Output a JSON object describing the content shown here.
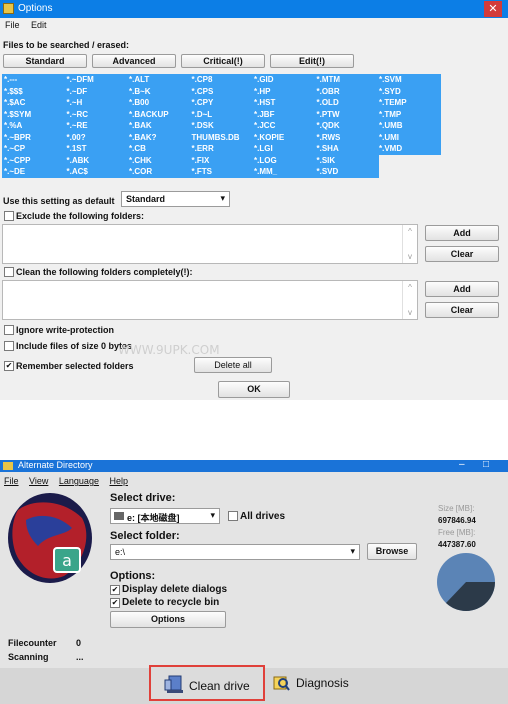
{
  "options_window": {
    "title": "Options",
    "close_label": "✕",
    "menu": [
      "File",
      "Edit"
    ],
    "files_label": "Files to be searched / erased:",
    "buttons": [
      "Standard",
      "Advanced",
      "Critical(!)",
      "Edit(!)"
    ],
    "ext_columns": [
      [
        "*.---",
        "*.$$$",
        "*.$AC",
        "*.$SYM",
        "*.%A",
        "*.~BPR",
        "*.~CP",
        "*.~CPP",
        "*.~DE"
      ],
      [
        "*.~DFM",
        "*.~DF",
        "*.~H",
        "*.~RC",
        "*.~RE",
        "*.00?",
        "*.1ST",
        "*.ABK",
        "*.AC$"
      ],
      [
        "*.ALT",
        "*.B~K",
        "*.B00",
        "*.BACKUP",
        "*.BAK",
        "*.BAK?",
        "*.CB",
        "*.CHK",
        "*.COR"
      ],
      [
        "*.CP8",
        "*.CPS",
        "*.CPY",
        "*.D~L",
        "*.DSK",
        "THUMBS.DB",
        "*.ERR",
        "*.FIX",
        "*.FTS"
      ],
      [
        "*.GID",
        "*.HP",
        "*.HST",
        "*.JBF",
        "*.JCC",
        "*.KOPIE",
        "*.LGI",
        "*.LOG",
        "*.MM_"
      ],
      [
        "*.MTM",
        "*.OBR",
        "*.OLD",
        "*.PTW",
        "*.QDK",
        "*.RWS",
        "*.SHA",
        "*.SIK",
        "*.SVD"
      ],
      [
        "*.SVM",
        "*.SYD",
        "*.TEMP",
        "*.TMP",
        "*.UMB",
        "*.UMI",
        "*.VMD"
      ]
    ],
    "default_label": "Use this setting as default",
    "default_value": "Standard",
    "exclude_label": "Exclude the following folders:",
    "clean_label": "Clean the following folders completely(!):",
    "add_label": "Add",
    "clear_label": "Clear",
    "ignore_label": "Ignore write-protection",
    "include_label": "Include files of size 0 bytes",
    "remember_label": "Remember selected folders",
    "delete_all_label": "Delete all",
    "ok_label": "OK",
    "scroll_up": "^",
    "scroll_down": "v",
    "check_mark": "✔"
  },
  "watermark": "WWW.9UPK.COM",
  "alt_window": {
    "title": "Alternate Directory",
    "win_controls": [
      "–",
      "□"
    ],
    "menu": [
      "File",
      "View",
      "Language",
      "Help"
    ],
    "select_drive_label": "Select drive:",
    "drive_value": "e: [本地磁盘]",
    "all_drives_label": "All drives",
    "select_folder_label": "Select folder:",
    "folder_value": "e:\\",
    "browse_label": "Browse",
    "options_label": "Options:",
    "display_delete_label": "Display delete dialogs",
    "delete_recycle_label": "Delete to recycle bin",
    "options_button_label": "Options",
    "size_label": "Size [MB]:",
    "size_value": "697846.94",
    "free_label": "Free [MB]:",
    "free_value": "447387.60",
    "filecounter_label": "Filecounter",
    "filecounter_value": "0",
    "scanning_label": "Scanning",
    "scanning_value": "...",
    "clean_drive_label": "Clean drive",
    "diagnosis_label": "Diagnosis",
    "chevron": "▾",
    "check_mark": "✔"
  },
  "colors": {
    "accent": "#0c7ee6",
    "ext_bg": "#3aa0f3",
    "highlight_border": "#e0403a",
    "pie_main": "#5b84b6",
    "pie_slice": "#2c3a49"
  }
}
